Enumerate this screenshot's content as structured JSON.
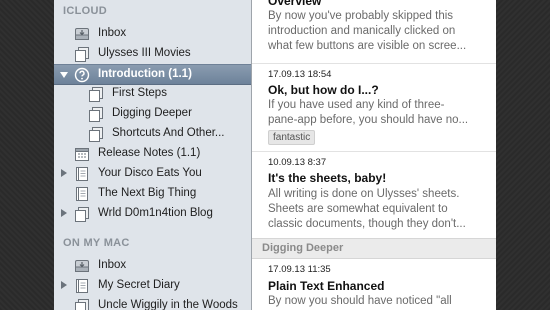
{
  "sidebar": {
    "icloud_header": "ICLOUD",
    "mac_header": "ON MY MAC",
    "icloud_items": [
      {
        "label": "Inbox",
        "icon": "inbox-icon"
      },
      {
        "label": "Ulysses III Movies",
        "icon": "group-icon"
      },
      {
        "label": "Introduction (1.1)",
        "icon": "help-icon",
        "selected": true
      },
      {
        "label": "First Steps",
        "icon": "group-icon"
      },
      {
        "label": "Digging Deeper",
        "icon": "group-icon"
      },
      {
        "label": "Shortcuts And Other...",
        "icon": "group-icon"
      },
      {
        "label": "Release Notes (1.1)",
        "icon": "calendar-icon"
      },
      {
        "label": "Your Disco Eats You",
        "icon": "notebook-icon"
      },
      {
        "label": "The Next Big Thing",
        "icon": "notebook-icon"
      },
      {
        "label": "Wrld D0m1n4tion Blog",
        "icon": "group-icon"
      }
    ],
    "mac_items": [
      {
        "label": "Inbox",
        "icon": "inbox-icon"
      },
      {
        "label": "My Secret Diary",
        "icon": "notebook-icon"
      },
      {
        "label": "Uncle Wiggily in the Woods",
        "icon": "group-icon"
      }
    ]
  },
  "sheets": [
    {
      "title": "Overview",
      "snippet": [
        "By now you've probably skipped this",
        "introduction and manically clicked on",
        "what few buttons are visible on scree..."
      ]
    },
    {
      "date": "17.09.13 18:54",
      "title": "Ok, but how do I...?",
      "snippet": [
        "If you have used any kind of three-",
        "pane-app before, you should have no..."
      ],
      "tag": "fantastic"
    },
    {
      "date": "10.09.13 8:37",
      "title": "It's the sheets, baby!",
      "snippet": [
        "All writing is done on Ulysses' sheets.",
        "Sheets are somewhat equivalent to",
        "classic documents, though they don't..."
      ]
    }
  ],
  "group": {
    "label": "Digging Deeper",
    "sheets": [
      {
        "date": "17.09.13 11:35",
        "title": "Plain Text Enhanced",
        "snippet": [
          "By now you should have noticed \"all"
        ]
      }
    ]
  },
  "colors": {
    "sidebar_bg": "#dfe4ea",
    "selection": "#7a8da4",
    "list_bg": "#ffffff",
    "backdrop": "#2b2b2b"
  }
}
